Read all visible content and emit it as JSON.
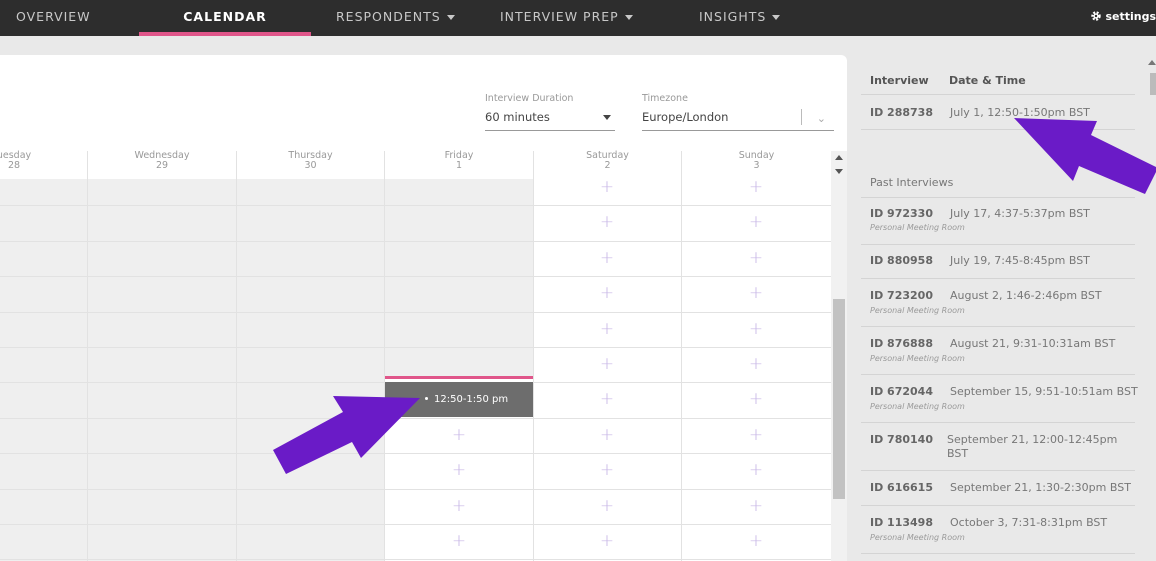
{
  "nav": {
    "items": [
      {
        "label": "OVERVIEW",
        "has_caret": false
      },
      {
        "label": "CALENDAR",
        "has_caret": false,
        "active": true
      },
      {
        "label": "RESPONDENTS",
        "has_caret": true
      },
      {
        "label": "INTERVIEW PREP",
        "has_caret": true
      },
      {
        "label": "INSIGHTS",
        "has_caret": true
      }
    ],
    "settings_label": "settings",
    "settings_icon": "gear-icon",
    "accent_color": "#e0568a"
  },
  "controls": {
    "duration_label": "Interview Duration",
    "duration_value": "60 minutes",
    "timezone_label": "Timezone",
    "timezone_value": "Europe/London"
  },
  "calendar": {
    "days": [
      {
        "name": "uesday",
        "date": "28"
      },
      {
        "name": "Wednesday",
        "date": "29"
      },
      {
        "name": "Thursday",
        "date": "30"
      },
      {
        "name": "Friday",
        "date": "1"
      },
      {
        "name": "Saturday",
        "date": "2"
      },
      {
        "name": "Sunday",
        "date": "3"
      }
    ],
    "event_label": "12:50-1:50 pm",
    "event_color": "#6d6d6d",
    "add_slot_icon": "plus-icon",
    "add_slot_color": "#c7b6e6"
  },
  "panel": {
    "col_interview": "Interview",
    "col_datetime": "Date & Time",
    "upcoming": [
      {
        "id": "ID 288738",
        "datetime": "July 1, 12:50-1:50pm BST"
      }
    ],
    "past_title": "Past Interviews",
    "past": [
      {
        "id": "ID 972330",
        "datetime": "July 17, 4:37-5:37pm BST",
        "room": "Personal Meeting Room"
      },
      {
        "id": "ID 880958",
        "datetime": "July 19, 7:45-8:45pm BST",
        "room": ""
      },
      {
        "id": "ID 723200",
        "datetime": "August 2, 1:46-2:46pm BST",
        "room": "Personal Meeting Room"
      },
      {
        "id": "ID 876888",
        "datetime": "August 21, 9:31-10:31am BST",
        "room": "Personal Meeting Room"
      },
      {
        "id": "ID 672044",
        "datetime": "September 15, 9:51-10:51am BST",
        "room": "Personal Meeting Room"
      },
      {
        "id": "ID 780140",
        "datetime": "September 21, 12:00-12:45pm BST",
        "room": ""
      },
      {
        "id": "ID 616615",
        "datetime": "September 21, 1:30-2:30pm BST",
        "room": ""
      },
      {
        "id": "ID 113498",
        "datetime": "October 3, 7:31-8:31pm BST",
        "room": "Personal Meeting Room"
      }
    ]
  },
  "annotation_color": "#6a1bc7"
}
